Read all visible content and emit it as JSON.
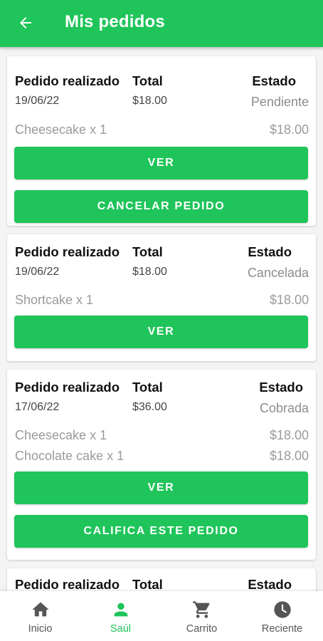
{
  "appbar": {
    "title": "Mis pedidos"
  },
  "labels": {
    "placed": "Pedido realizado",
    "total": "Total",
    "status": "Estado"
  },
  "orders": [
    {
      "date": "19/06/22",
      "total": "$18.00",
      "status": "Pendiente",
      "items": [
        {
          "name": "Cheesecake x 1",
          "price": "$18.00"
        }
      ],
      "buttons": [
        "VER",
        "CANCELAR PEDIDO"
      ]
    },
    {
      "date": "19/06/22",
      "total": "$18.00",
      "status": "Cancelada",
      "items": [
        {
          "name": "Shortcake x 1",
          "price": "$18.00"
        }
      ],
      "buttons": [
        "VER"
      ]
    },
    {
      "date": "17/06/22",
      "total": "$36.00",
      "status": "Cobrada",
      "items": [
        {
          "name": "Cheesecake x 1",
          "price": "$18.00"
        },
        {
          "name": "Chocolate cake x 1",
          "price": "$18.00"
        }
      ],
      "buttons": [
        "VER",
        "CALIFICA ESTE PEDIDO"
      ]
    }
  ],
  "bottom_nav": [
    {
      "label": "Inicio",
      "icon": "home-icon"
    },
    {
      "label": "Saúl",
      "icon": "person-icon",
      "active": true
    },
    {
      "label": "Carrito",
      "icon": "cart-icon"
    },
    {
      "label": "Reciente",
      "icon": "clock-icon"
    }
  ],
  "colors": {
    "primary": "#1fc45a",
    "background": "#f4f4f4"
  }
}
